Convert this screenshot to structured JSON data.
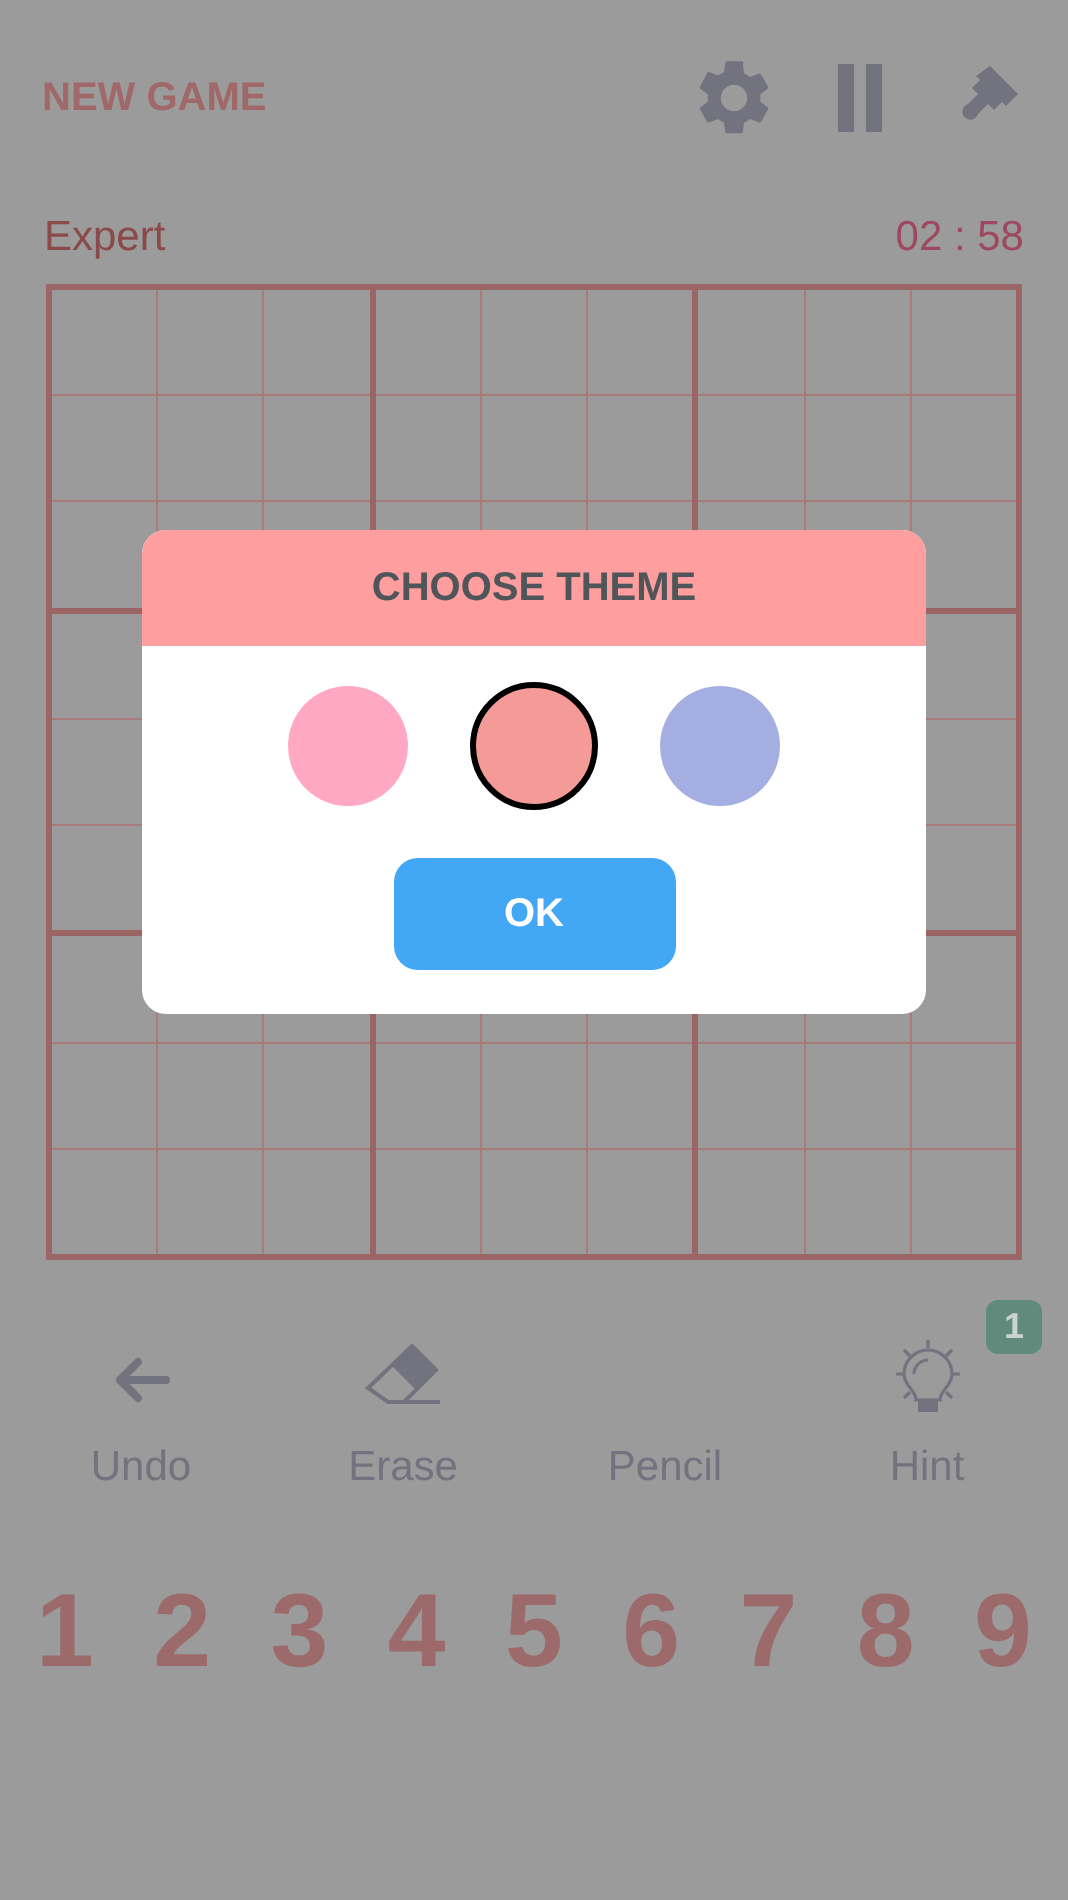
{
  "header": {
    "title": "NEW GAME"
  },
  "game": {
    "difficulty": "Expert",
    "timer": "02 : 58"
  },
  "dialog": {
    "title": "CHOOSE THEME",
    "themes": [
      {
        "color": "#ffa8c4",
        "selected": false
      },
      {
        "color": "#f49a97",
        "selected": true
      },
      {
        "color": "#a5aee0",
        "selected": false
      }
    ],
    "button": "OK"
  },
  "tools": [
    {
      "kind": "undo",
      "label": "Undo"
    },
    {
      "kind": "erase",
      "label": "Erase"
    },
    {
      "kind": "pencil",
      "label": "Pencil"
    },
    {
      "kind": "hint",
      "label": "Hint",
      "badge": "1"
    }
  ],
  "numbers": [
    "1",
    "2",
    "3",
    "4",
    "5",
    "6",
    "7",
    "8",
    "9"
  ]
}
